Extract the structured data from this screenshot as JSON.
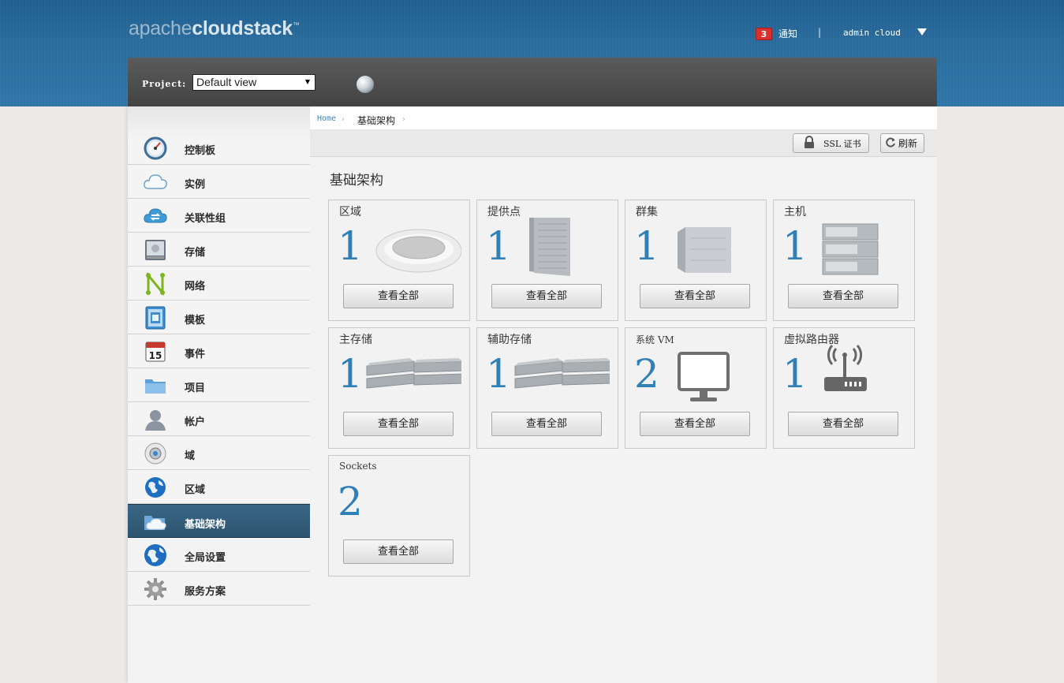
{
  "header": {
    "logo_part1": "apache",
    "logo_part2": "cloudstack",
    "logo_tm": "™",
    "notification_count": "3",
    "notification_label": "通知",
    "separator": "|",
    "user": "admin cloud"
  },
  "project": {
    "label": "Project:",
    "selected": "Default view"
  },
  "sidebar": {
    "items": [
      {
        "label": "控制板",
        "icon": "dashboard-gauge-icon"
      },
      {
        "label": "实例",
        "icon": "cloud-icon"
      },
      {
        "label": "关联性组",
        "icon": "affinity-cloud-arrows-icon"
      },
      {
        "label": "存储",
        "icon": "storage-disk-icon"
      },
      {
        "label": "网络",
        "icon": "network-icon"
      },
      {
        "label": "模板",
        "icon": "template-icon"
      },
      {
        "label": "事件",
        "icon": "calendar-icon",
        "day": "15"
      },
      {
        "label": "项目",
        "icon": "folder-icon"
      },
      {
        "label": "帐户",
        "icon": "user-icon"
      },
      {
        "label": "域",
        "icon": "domain-disc-icon"
      },
      {
        "label": "区域",
        "icon": "globe-icon"
      },
      {
        "label": "基础架构",
        "icon": "infrastructure-folder-cloud-icon",
        "active": true
      },
      {
        "label": "全局设置",
        "icon": "global-settings-globe-icon"
      },
      {
        "label": "服务方案",
        "icon": "gear-icon"
      }
    ]
  },
  "breadcrumb": {
    "home": "Home",
    "arrow": "›",
    "current": "基础架构"
  },
  "toolbar": {
    "ssl_label": "SSL 证书",
    "refresh_label": "刷新"
  },
  "page_title": "基础架构",
  "cards": [
    {
      "title": "区域",
      "count": "1",
      "button": "查看全部",
      "icon": "zone-disc-icon"
    },
    {
      "title": "提供点",
      "count": "1",
      "button": "查看全部",
      "icon": "pod-rack-icon"
    },
    {
      "title": "群集",
      "count": "1",
      "button": "查看全部",
      "icon": "cluster-box-icon"
    },
    {
      "title": "主机",
      "count": "1",
      "button": "查看全部",
      "icon": "host-server-icon"
    },
    {
      "title": "主存储",
      "count": "1",
      "button": "查看全部",
      "icon": "primary-storage-disks-icon"
    },
    {
      "title": "辅助存储",
      "count": "1",
      "button": "查看全部",
      "icon": "secondary-storage-disks-icon"
    },
    {
      "title": "系统 VM",
      "count": "2",
      "button": "查看全部",
      "icon": "monitor-icon"
    },
    {
      "title": "虚拟路由器",
      "count": "1",
      "button": "查看全部",
      "icon": "router-icon"
    },
    {
      "title": "Sockets",
      "count": "2",
      "button": "查看全部",
      "icon": ""
    }
  ],
  "colors": {
    "header_bg": "#2a6d9e",
    "accent_number": "#2f7fb8",
    "active_nav": "#2d5470",
    "badge": "#d9302c"
  }
}
